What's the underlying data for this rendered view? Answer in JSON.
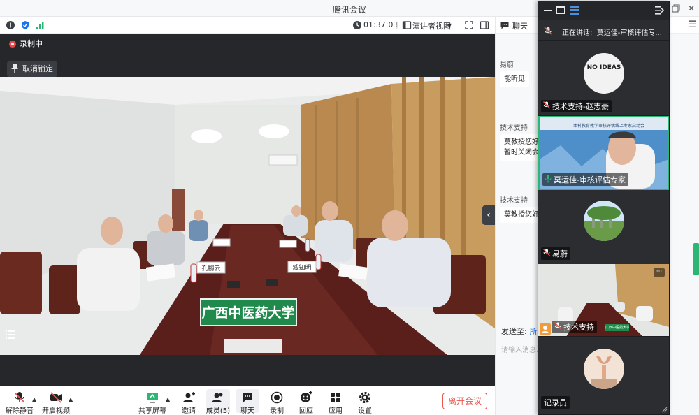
{
  "window": {
    "title": "腾讯会议"
  },
  "infobar": {
    "timer": "01:37:03",
    "view_mode": "演讲者视图"
  },
  "stage": {
    "recording_label": "录制中",
    "unpin_label": "取消锁定",
    "banner_text": "广西中医药大学",
    "nameplates": [
      "孔鹏云",
      "臧知明"
    ]
  },
  "toolbar": {
    "mute": "解除静音",
    "video": "开启视频",
    "share": "共享屏幕",
    "invite": "邀请",
    "members": "成员(5)",
    "chat": "聊天",
    "record": "录制",
    "reactions": "回应",
    "apps": "应用",
    "settings": "设置",
    "leave": "离开会议"
  },
  "chat": {
    "title": "聊天",
    "messages": [
      {
        "sender": "易蔚",
        "text": "能听见"
      },
      {
        "sender": "技术支持",
        "text": "莫教授您好",
        "text2": "暂时关闭会"
      },
      {
        "sender": "技术支持",
        "text": "莫教授您好"
      }
    ],
    "send_to_label": "发送至:",
    "send_to_target": "所",
    "input_placeholder": "请输入消息..."
  },
  "participants": {
    "speaking_prefix": "正在讲话:",
    "speaking_name": "莫运佳-审核评估专...",
    "tiles": [
      {
        "name": "技术支持-赵志豪",
        "avatar_text": "NO IDEAS"
      },
      {
        "name": "莫运佳-审核评估专家",
        "video_banner": "本科教育教学审核评估线上专家启动会"
      },
      {
        "name": "易蔚"
      },
      {
        "name": "技术支持",
        "video_banner": "广西中医药大学"
      },
      {
        "name": "记录员"
      }
    ]
  },
  "colors": {
    "accent": "#1a73e8",
    "leave": "#e8584f",
    "active_speaker": "#2bb673",
    "stage_bg": "#25272b"
  }
}
